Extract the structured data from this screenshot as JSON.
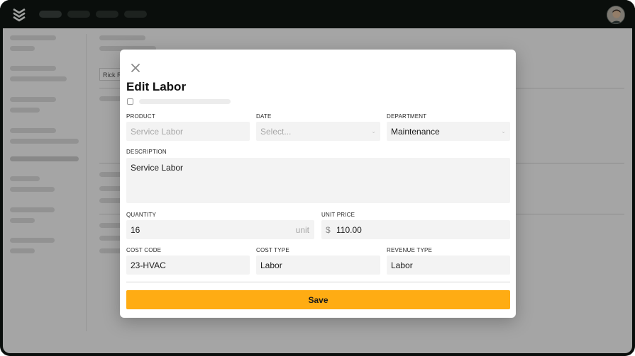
{
  "background": {
    "breadcrumb": "Rick Ru"
  },
  "modal": {
    "title": "Edit Labor",
    "fields": {
      "product": {
        "label": "PRODUCT",
        "value": "Service Labor"
      },
      "date": {
        "label": "DATE",
        "placeholder": "Select..."
      },
      "department": {
        "label": "DEPARTMENT",
        "value": "Maintenance"
      },
      "description": {
        "label": "DESCRIPTION",
        "value": "Service Labor"
      },
      "quantity": {
        "label": "QUANTITY",
        "value": "16",
        "unit": "unit"
      },
      "unit_price": {
        "label": "UNIT PRICE",
        "currency": "$",
        "value": "110.00"
      },
      "cost_code": {
        "label": "COST CODE",
        "value": "23-HVAC"
      },
      "cost_type": {
        "label": "COST TYPE",
        "value": "Labor"
      },
      "revenue_type": {
        "label": "REVENUE TYPE",
        "value": "Labor"
      }
    },
    "save_label": "Save"
  },
  "colors": {
    "topbar": "#0f1512",
    "accent": "#ffac13",
    "field_bg": "#f3f3f3"
  },
  "icons": {
    "logo": "stacked-chevrons-logo",
    "close": "close-icon"
  }
}
